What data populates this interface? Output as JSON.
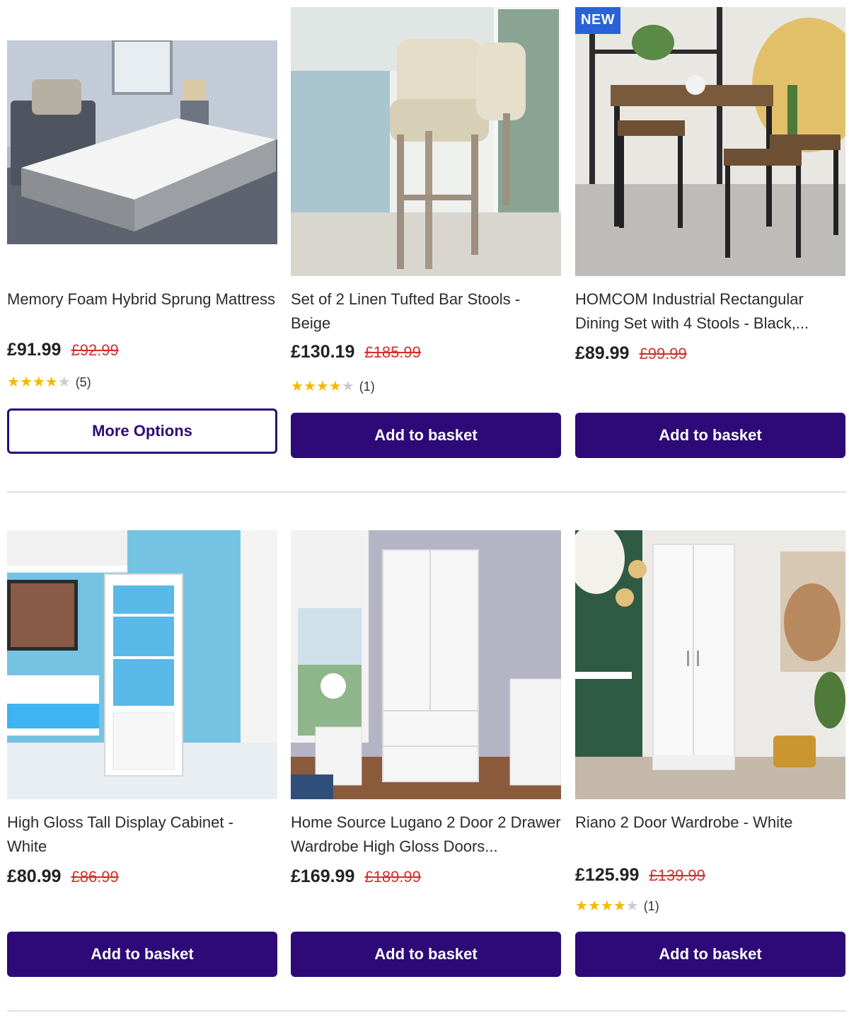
{
  "rows": [
    {
      "products": [
        {
          "title": "Memory Foam Hybrid Sprung Mattress",
          "price": "£91.99",
          "was_price": "£92.99",
          "rating_stars": 4,
          "rating_count": "(5)",
          "badge": "",
          "button_label": "More Options",
          "button_style": "secondary"
        },
        {
          "title": "Set of 2 Linen Tufted Bar Stools - Beige",
          "price": "£130.19",
          "was_price": "£185.99",
          "rating_stars": 4,
          "rating_count": "(1)",
          "badge": "",
          "button_label": "Add to basket",
          "button_style": "primary"
        },
        {
          "title": "HOMCOM Industrial Rectangular Dining Set with 4 Stools - Black,...",
          "price": "£89.99",
          "was_price": "£99.99",
          "rating_stars": 0,
          "rating_count": "",
          "badge": "NEW",
          "button_label": "Add to basket",
          "button_style": "primary"
        }
      ]
    },
    {
      "products": [
        {
          "title": "High Gloss Tall Display Cabinet - White",
          "price": "£80.99",
          "was_price": "£86.99",
          "rating_stars": 0,
          "rating_count": "",
          "badge": "",
          "button_label": "Add to basket",
          "button_style": "primary"
        },
        {
          "title": "Home Source Lugano 2 Door 2 Drawer Wardrobe High Gloss Doors...",
          "price": "£169.99",
          "was_price": "£189.99",
          "rating_stars": 0,
          "rating_count": "",
          "badge": "",
          "button_label": "Add to basket",
          "button_style": "primary"
        },
        {
          "title": "Riano 2 Door Wardrobe - White",
          "price": "£125.99",
          "was_price": "£139.99",
          "rating_stars": 4,
          "rating_count": "(1)",
          "badge": "",
          "button_label": "Add to basket",
          "button_style": "primary"
        }
      ]
    }
  ],
  "colors": {
    "brand_purple": "#2d0a78",
    "was_price_red": "#d0312d",
    "star_gold": "#f5b800",
    "star_empty": "#c9ccd1",
    "badge_blue": "#2a63d8",
    "divider": "#d9e2ea"
  },
  "icons": {
    "star": "star-icon"
  }
}
